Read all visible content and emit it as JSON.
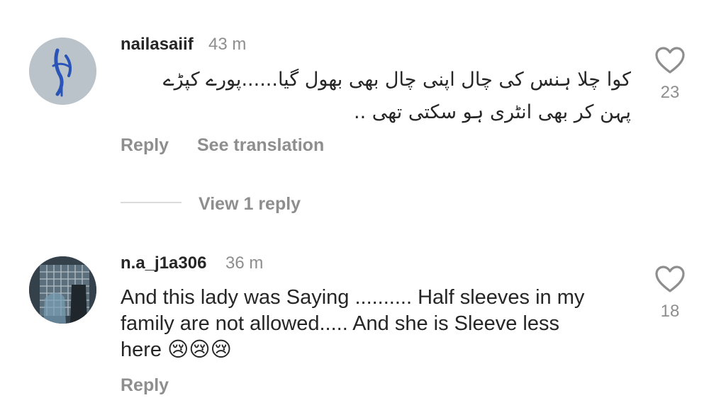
{
  "comments": [
    {
      "username": "nailasaiif",
      "time": "43 m",
      "text_line1": "کوا چلا ہنس کی چال اپنی چال بھی بھول گیا......پورے کپڑے",
      "text_line2": "پہن کر بھی انٹری ہو سکتی تھی ..",
      "likes": "23",
      "reply_label": "Reply",
      "translate_label": "See translation",
      "view_replies_label": "View 1 reply",
      "avatar_icon": "calligraphy-avatar-icon"
    },
    {
      "username": "n.a_j1a306",
      "time": "36 m",
      "text_line1": "And this lady was Saying .......... Half sleeves in my",
      "text_line2": "family are not allowed..... And she is Sleeve less",
      "text_line3": "here 😢😢😢",
      "likes": "18",
      "reply_label": "Reply",
      "avatar_icon": "photo-avatar-icon"
    }
  ],
  "colors": {
    "primary_text": "#262626",
    "secondary_text": "#8e8e8e",
    "divider": "#dbdbdb"
  }
}
